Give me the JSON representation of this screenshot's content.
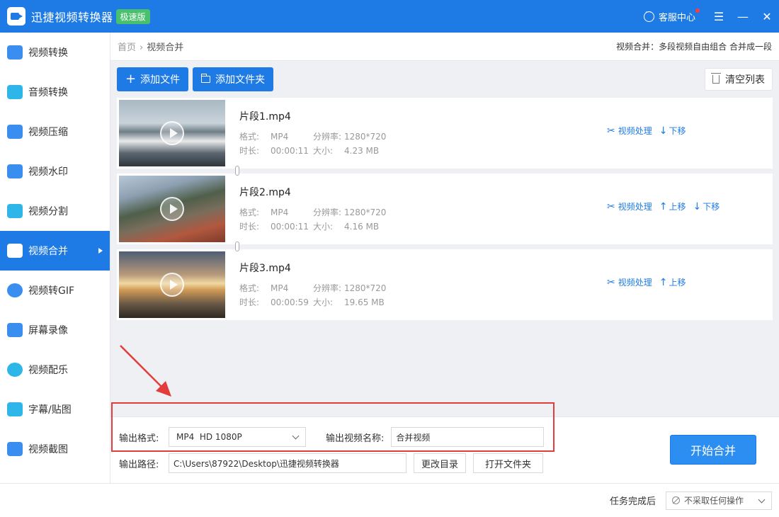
{
  "app": {
    "title": "迅捷视频转换器",
    "edition": "极速版",
    "service": "客服中心"
  },
  "sidebar": {
    "items": [
      {
        "label": "视频转换",
        "icon": "video-convert-icon",
        "active": false
      },
      {
        "label": "音频转换",
        "icon": "audio-convert-icon",
        "active": false
      },
      {
        "label": "视频压缩",
        "icon": "video-compress-icon",
        "active": false
      },
      {
        "label": "视频水印",
        "icon": "video-watermark-icon",
        "active": false
      },
      {
        "label": "视频分割",
        "icon": "video-split-icon",
        "active": false
      },
      {
        "label": "视频合并",
        "icon": "video-merge-icon",
        "active": true
      },
      {
        "label": "视频转GIF",
        "icon": "gif-icon",
        "active": false
      },
      {
        "label": "屏幕录像",
        "icon": "screen-record-icon",
        "active": false
      },
      {
        "label": "视频配乐",
        "icon": "music-icon",
        "active": false
      },
      {
        "label": "字幕/贴图",
        "icon": "subtitle-icon",
        "active": false
      },
      {
        "label": "视频截图",
        "icon": "screenshot-icon",
        "active": false
      }
    ]
  },
  "breadcrumb": {
    "home": "首页",
    "current": "视频合并"
  },
  "feature_desc": "视频合并：多段视频自由组合 合并成一段",
  "toolbar": {
    "add_file": "添加文件",
    "add_folder": "添加文件夹",
    "clear_list": "清空列表"
  },
  "labels": {
    "format": "格式:",
    "resolution": "分辨率:",
    "duration": "时长:",
    "size": "大小:",
    "process": "视频处理",
    "move_up": "上移",
    "move_down": "下移"
  },
  "files": [
    {
      "name": "片段1.mp4",
      "format": "MP4",
      "resolution": "1280*720",
      "duration": "00:00:11",
      "size": "4.23 MB"
    },
    {
      "name": "片段2.mp4",
      "format": "MP4",
      "resolution": "1280*720",
      "duration": "00:00:11",
      "size": "4.16 MB"
    },
    {
      "name": "片段3.mp4",
      "format": "MP4",
      "resolution": "1280*720",
      "duration": "00:00:59",
      "size": "19.65 MB"
    }
  ],
  "output": {
    "format_label": "输出格式:",
    "format_value": "MP4  HD 1080P",
    "name_label": "输出视频名称:",
    "name_value": "合并视频",
    "path_label": "输出路径:",
    "path_value": "C:\\Users\\87922\\Desktop\\迅捷视频转换器",
    "change_dir": "更改目录",
    "open_folder": "打开文件夹",
    "start": "开始合并"
  },
  "status": {
    "after_label": "任务完成后",
    "after_value": "不采取任何操作"
  },
  "colors": {
    "brand": "#1e7be6",
    "badge": "#49c06b",
    "annotation": "#e23c3c"
  }
}
